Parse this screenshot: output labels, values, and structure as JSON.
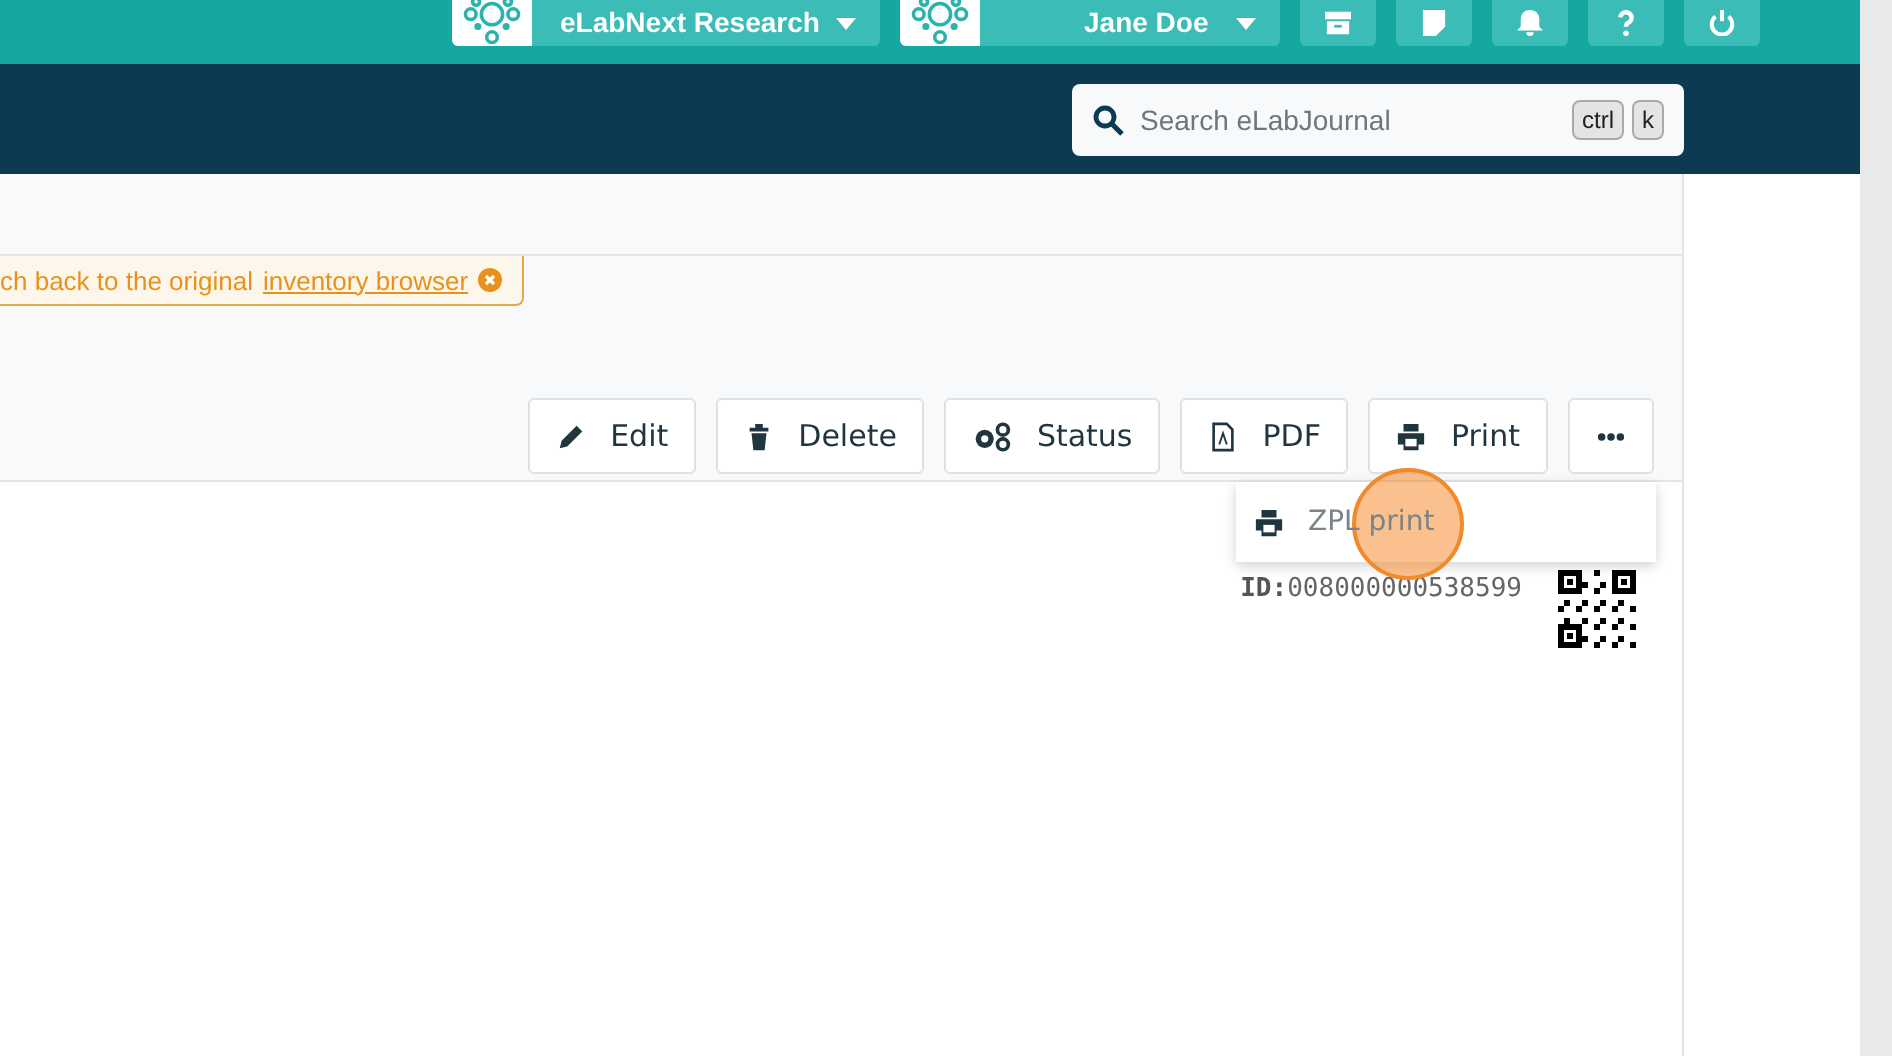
{
  "header": {
    "workspace": "eLabNext Research",
    "user": "Jane Doe"
  },
  "search": {
    "placeholder": "Search eLabJournal",
    "keys": [
      "ctrl",
      "k"
    ]
  },
  "notice": {
    "text": "ch back to the original",
    "link": "inventory browser"
  },
  "toolbar": [
    {
      "label": "Edit"
    },
    {
      "label": "Delete"
    },
    {
      "label": "Status"
    },
    {
      "label": "PDF"
    },
    {
      "label": "Print"
    },
    {
      "kind": "more"
    }
  ],
  "menu": [
    {
      "label": "ZPL print"
    }
  ],
  "item": {
    "id_label": "ID:",
    "id_value": "008000000538599"
  }
}
